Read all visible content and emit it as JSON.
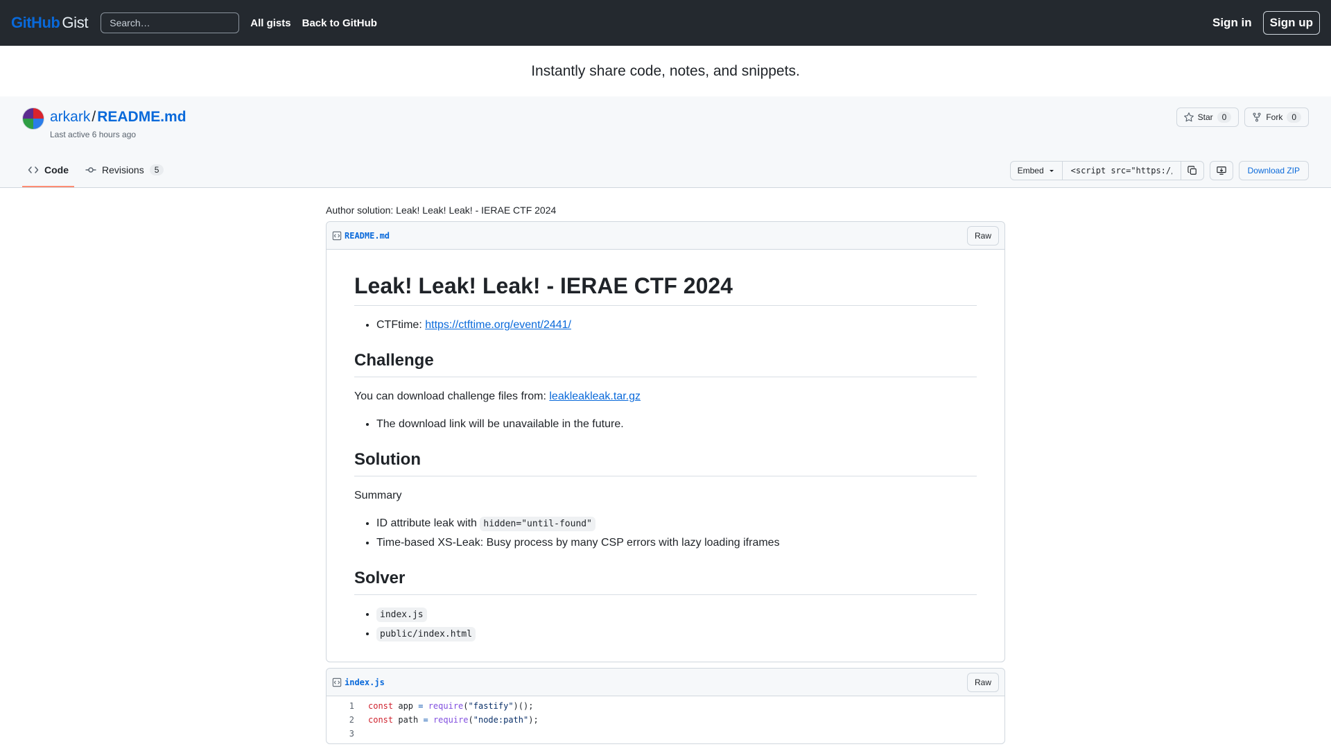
{
  "header": {
    "logo_primary": "GitHub",
    "logo_secondary": "Gist",
    "search_placeholder": "Search…",
    "nav": [
      "All gists",
      "Back to GitHub"
    ],
    "signin": "Sign in",
    "signup": "Sign up"
  },
  "tagline": "Instantly share code, notes, and snippets.",
  "gist": {
    "owner": "arkark",
    "separator": "/",
    "filename": "README.md",
    "last_active": "Last active 6 hours ago",
    "star_label": "Star",
    "star_count": "0",
    "fork_label": "Fork",
    "fork_count": "0",
    "tabs": [
      {
        "label": "Code",
        "icon": "code-icon"
      },
      {
        "label": "Revisions",
        "icon": "commit-icon",
        "count": "5"
      }
    ],
    "embed_label": "Embed",
    "embed_value": "<script src=\"https://",
    "download_zip": "Download ZIP"
  },
  "description": "Author solution: Leak! Leak! Leak! - IERAE CTF 2024",
  "files": [
    {
      "name": "README.md",
      "raw_label": "Raw",
      "markdown": {
        "h1": "Leak! Leak! Leak! - IERAE CTF 2024",
        "ctftime_prefix": "CTFtime: ",
        "ctftime_link": "https://ctftime.org/event/2441/",
        "h2_challenge": "Challenge",
        "challenge_text": "You can download challenge files from: ",
        "challenge_link": "leakleakleak.tar.gz",
        "challenge_note": "The download link will be unavailable in the future.",
        "h2_solution": "Solution",
        "summary": "Summary",
        "solution_item1_prefix": "ID attribute leak with ",
        "solution_item1_code": "hidden=\"until-found\"",
        "solution_item2": "Time-based XS-Leak: Busy process by many CSP errors with lazy loading iframes",
        "h2_solver": "Solver",
        "solver_items": [
          "index.js",
          "public/index.html"
        ]
      }
    },
    {
      "name": "index.js",
      "raw_label": "Raw",
      "lines": [
        {
          "n": "1",
          "kw": "const",
          "var": " app ",
          "op": "=",
          "fn": " require",
          "p1": "(",
          "str": "\"fastify\"",
          "p2": ")();"
        },
        {
          "n": "2",
          "kw": "const",
          "var": " path ",
          "op": "=",
          "fn": " require",
          "p1": "(",
          "str": "\"node:path\"",
          "p2": ");"
        },
        {
          "n": "3"
        }
      ]
    }
  ],
  "colors": {
    "header_bg": "#24292f",
    "link": "#0969da",
    "tab_active_underline": "#fd8c73"
  }
}
